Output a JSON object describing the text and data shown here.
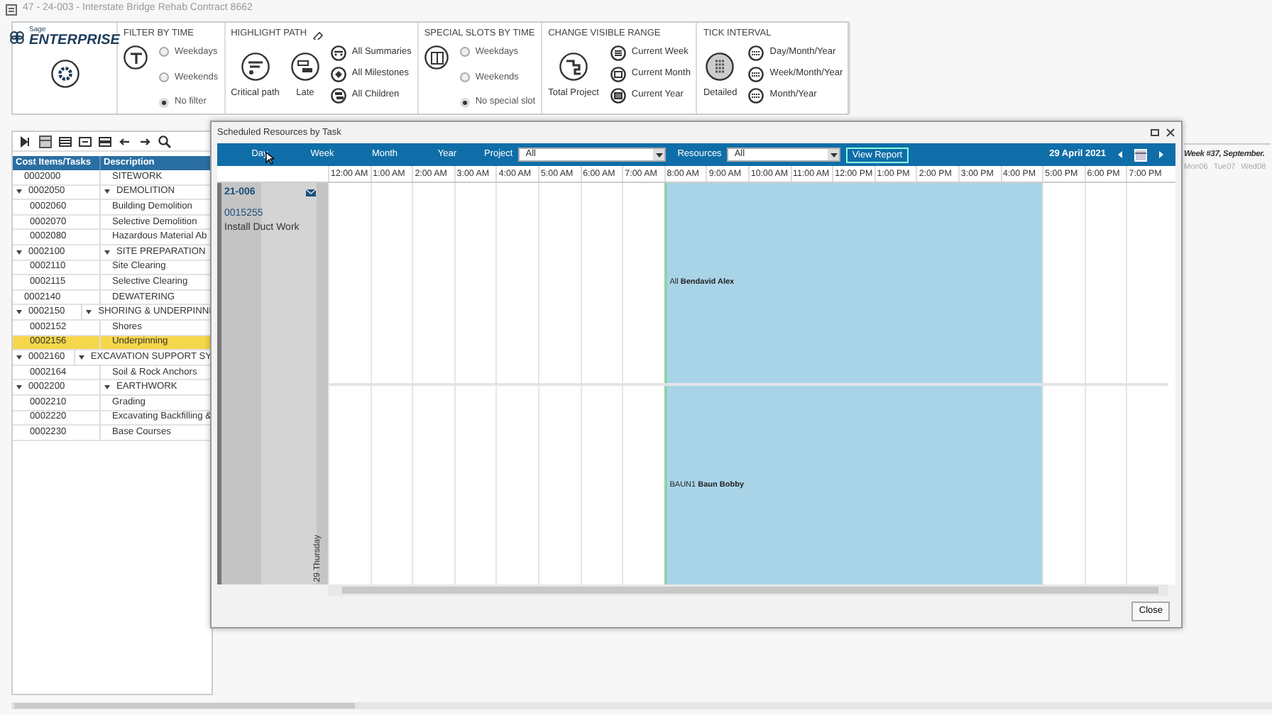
{
  "window": {
    "title": "47 - 24-003 - Interstate Bridge Rehab Contract 8662"
  },
  "logo": {
    "small": "Sage",
    "text": "ENTERPRISE"
  },
  "ribbon": [
    {
      "kind": "filter",
      "title": "FILTER BY TIME",
      "radios": [
        {
          "label": "Weekdays",
          "selected": false
        },
        {
          "label": "Weekends",
          "selected": false
        },
        {
          "label": "No filter",
          "selected": true
        }
      ]
    },
    {
      "kind": "highlight",
      "title": "HIGHLIGHT PATH",
      "big": [
        {
          "label": "Critical path"
        },
        {
          "label": "Late"
        }
      ],
      "small": [
        {
          "label": "All Summaries"
        },
        {
          "label": "All Milestones"
        },
        {
          "label": "All Children"
        }
      ]
    },
    {
      "kind": "slots",
      "title": "SPECIAL SLOTS BY TIME",
      "radios": [
        {
          "label": "Weekdays",
          "selected": false
        },
        {
          "label": "Weekends",
          "selected": false
        },
        {
          "label": "No special slot",
          "selected": true
        }
      ]
    },
    {
      "kind": "range",
      "title": "CHANGE VISIBLE RANGE",
      "big": [
        {
          "label": "Total Project"
        }
      ],
      "small": [
        {
          "label": "Current Week"
        },
        {
          "label": "Current Month"
        },
        {
          "label": "Current Year"
        }
      ]
    },
    {
      "kind": "ticks",
      "title": "TICK INTERVAL",
      "big": [
        {
          "label": "Detailed",
          "selected": true
        }
      ],
      "small": [
        {
          "label": "Day/Month/Year"
        },
        {
          "label": "Week/Month/Year"
        },
        {
          "label": "Month/Year"
        }
      ]
    }
  ],
  "grid": {
    "columns": [
      "Cost Items/Tasks",
      "Description"
    ],
    "rows": [
      {
        "code": "0002000",
        "description": "SITEWORK",
        "selected": false
      },
      {
        "code": "0002050",
        "description": "DEMOLITION",
        "selected": false,
        "expanded": true,
        "children": [
          {
            "code": "0002060",
            "description": "Building Demolition",
            "selected": false
          },
          {
            "code": "0002070",
            "description": "Selective Demolition",
            "selected": false
          },
          {
            "code": "0002080",
            "description": "Hazardous Material Ab",
            "selected": false
          }
        ]
      },
      {
        "code": "0002100",
        "description": "SITE PREPARATION",
        "selected": false,
        "expanded": true,
        "children": [
          {
            "code": "0002110",
            "description": "Site Clearing",
            "selected": false
          },
          {
            "code": "0002115",
            "description": "Selective Clearing",
            "selected": false
          }
        ]
      },
      {
        "code": "0002140",
        "description": "DEWATERING",
        "selected": false
      },
      {
        "code": "0002150",
        "description": "SHORING & UNDERPINNI",
        "selected": false,
        "expanded": true,
        "children": [
          {
            "code": "0002152",
            "description": "Shores",
            "selected": false
          },
          {
            "code": "0002156",
            "description": "Underpinning",
            "selected": true
          }
        ]
      },
      {
        "code": "0002160",
        "description": "EXCAVATION SUPPORT SY",
        "selected": false,
        "expanded": true,
        "children": [
          {
            "code": "0002164",
            "description": "Soil & Rock Anchors",
            "selected": false
          }
        ]
      },
      {
        "code": "0002200",
        "description": "EARTHWORK",
        "selected": false,
        "expanded": true,
        "children": [
          {
            "code": "0002210",
            "description": "Grading",
            "selected": false
          },
          {
            "code": "0002220",
            "description": "Excavating Backfilling &",
            "selected": false
          },
          {
            "code": "0002230",
            "description": "Base Courses",
            "selected": false
          }
        ]
      }
    ]
  },
  "gantt": {
    "week": "Week #37, September.",
    "days": [
      "Mon06",
      "Tue07",
      "Wed08"
    ]
  },
  "dialog": {
    "title": "Scheduled Resources by Task",
    "views": [
      "Day",
      "Week",
      "Month",
      "Year"
    ],
    "project": {
      "label": "Project",
      "value": "All"
    },
    "resources": {
      "label": "Resources",
      "value": "All"
    },
    "view_report": "View Report",
    "date": "29 April 2021",
    "hours": [
      "12:00 AM",
      "1:00 AM",
      "2:00 AM",
      "3:00 AM",
      "4:00 AM",
      "5:00 AM",
      "6:00 AM",
      "7:00 AM",
      "8:00 AM",
      "9:00 AM",
      "10:00 AM",
      "11:00 AM",
      "12:00 PM",
      "1:00 PM",
      "2:00 PM",
      "3:00 PM",
      "4:00 PM",
      "5:00 PM",
      "6:00 PM",
      "7:00 PM"
    ],
    "task": {
      "code": "21-006",
      "number": "0015255",
      "name": "Install Duct Work",
      "day": "29 Thursday"
    },
    "lanes": [
      {
        "label": "All **Bendavid Alex**",
        "slots": [
          {
            "booked": false
          },
          {
            "booked": false
          },
          {
            "booked": false
          },
          {
            "booked": false
          },
          {
            "booked": false
          },
          {
            "booked": false
          },
          {
            "booked": false
          },
          {
            "booked": false
          },
          {
            "booked": true
          },
          {
            "booked": true
          },
          {
            "booked": true
          },
          {
            "booked": true
          },
          {
            "booked": true
          },
          {
            "booked": true
          },
          {
            "booked": true
          },
          {
            "booked": true
          },
          {
            "booked": true
          },
          {
            "booked": false
          },
          {
            "booked": false
          },
          {
            "booked": false
          }
        ]
      },
      {
        "label": "BAUN1 **Baun Bobby**",
        "slots": [
          {
            "booked": false
          },
          {
            "booked": false
          },
          {
            "booked": false
          },
          {
            "booked": false
          },
          {
            "booked": false
          },
          {
            "booked": false
          },
          {
            "booked": false
          },
          {
            "booked": false
          },
          {
            "booked": true
          },
          {
            "booked": true
          },
          {
            "booked": true
          },
          {
            "booked": true
          },
          {
            "booked": true
          },
          {
            "booked": true
          },
          {
            "booked": true
          },
          {
            "booked": true
          },
          {
            "booked": true
          },
          {
            "booked": false
          },
          {
            "booked": false
          },
          {
            "booked": false
          }
        ]
      }
    ],
    "close": "Close"
  }
}
